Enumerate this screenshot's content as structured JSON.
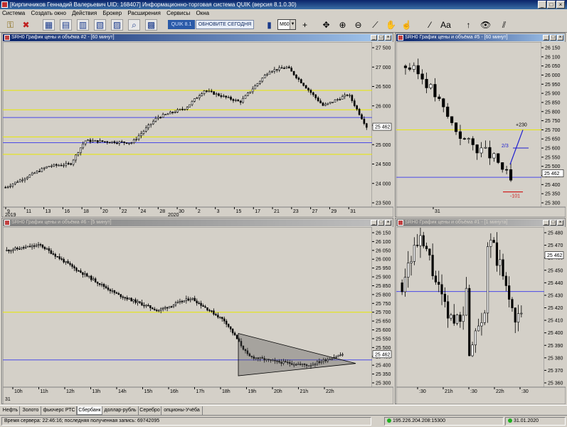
{
  "window": {
    "title": "[Кирпичников Геннадий Валерьевич UID: 168407] Информационно-торговая система QUIK (версия 8.1.0.30)",
    "minimize": "_",
    "maximize": "□",
    "close": "×"
  },
  "menu": [
    "Система",
    "Создать окно",
    "Действия",
    "Брокер",
    "Расширения",
    "Сервисы",
    "Окна"
  ],
  "toolbar": {
    "quik_version": "QUIK 8.1",
    "update_label": "ОБНОВИТЕ СЕГОДНЯ",
    "timeframe": "M60",
    "text_tool": "Aa"
  },
  "charts": [
    {
      "id": "c2",
      "title": "SRH0 График цены и объёма #2 - [60 минут]",
      "active": true,
      "price_labels": [
        "27 500",
        "27 000",
        "26 500",
        "26 000",
        "25 500",
        "25 000",
        "24 500",
        "24 000",
        "23 500"
      ],
      "last_price": "25 462",
      "x_labels": [
        "9",
        "11",
        "13",
        "16",
        "18",
        "20",
        "22",
        "24",
        "28",
        "30",
        "2",
        "3",
        "15",
        "17",
        "21",
        "23",
        "27",
        "29",
        "31"
      ],
      "years": [
        "2019",
        "2020"
      ]
    },
    {
      "id": "c5",
      "title": "SRH0 График цены и объёма #5 - [60 минут]",
      "active": false,
      "price_labels": [
        "26 150",
        "26 100",
        "26 050",
        "26 000",
        "25 950",
        "25 900",
        "25 850",
        "25 800",
        "25 750",
        "25 700",
        "25 650",
        "25 600",
        "25 550",
        "25 500",
        "25 450",
        "25 400",
        "25 350",
        "25 300"
      ],
      "last_price": "25 462",
      "x_labels": [
        "31"
      ],
      "annotations": {
        "up": "+230",
        "ratio": "2/3",
        "down": "-101"
      }
    },
    {
      "id": "c6",
      "title": "SRH0 График цены и объёма #6 - [5 минут]",
      "active": false,
      "price_labels": [
        "26 150",
        "26 100",
        "26 050",
        "26 000",
        "25 950",
        "25 900",
        "25 850",
        "25 800",
        "25 750",
        "25 700",
        "25 650",
        "25 600",
        "25 550",
        "25 500",
        "25 450",
        "25 400",
        "25 350",
        "25 300"
      ],
      "last_price": "25 462",
      "x_labels": [
        "10h",
        "11h",
        "12h",
        "13h",
        "14h",
        "15h",
        "16h",
        "17h",
        "18h",
        "19h",
        "20h",
        "21h",
        "22h"
      ],
      "date_label": "31"
    },
    {
      "id": "c1",
      "title": "SRH0 График цены и объёма #1 - [1 минута]",
      "active": false,
      "price_labels": [
        "25 480",
        "25 470",
        "25 460",
        "25 450",
        "25 440",
        "25 430",
        "25 420",
        "25 410",
        "25 400",
        "25 390",
        "25 380",
        "25 370",
        "25 360"
      ],
      "last_price": "25 462",
      "x_labels": [
        ":30",
        "21h",
        ":30",
        "22h",
        ":30"
      ]
    }
  ],
  "tabs": [
    "Нефть",
    "Золото",
    "фьючерс РТС",
    "Сбербанк",
    "доллар-рубль",
    "Серебро",
    "опционы-Учёба"
  ],
  "active_tab": "Сбербанк",
  "status": {
    "server_time": "Время сервера: 22:46:16; последняя полученная запись: 69742095",
    "connection": "195.226.204.208:15300",
    "date": "31.01.2020"
  },
  "colors": {
    "accent": "#0a246a",
    "support_yellow": "#e8e800",
    "level_blue": "#4a4ae8",
    "candle_up": "#ffffff",
    "candle_down": "#000000"
  }
}
